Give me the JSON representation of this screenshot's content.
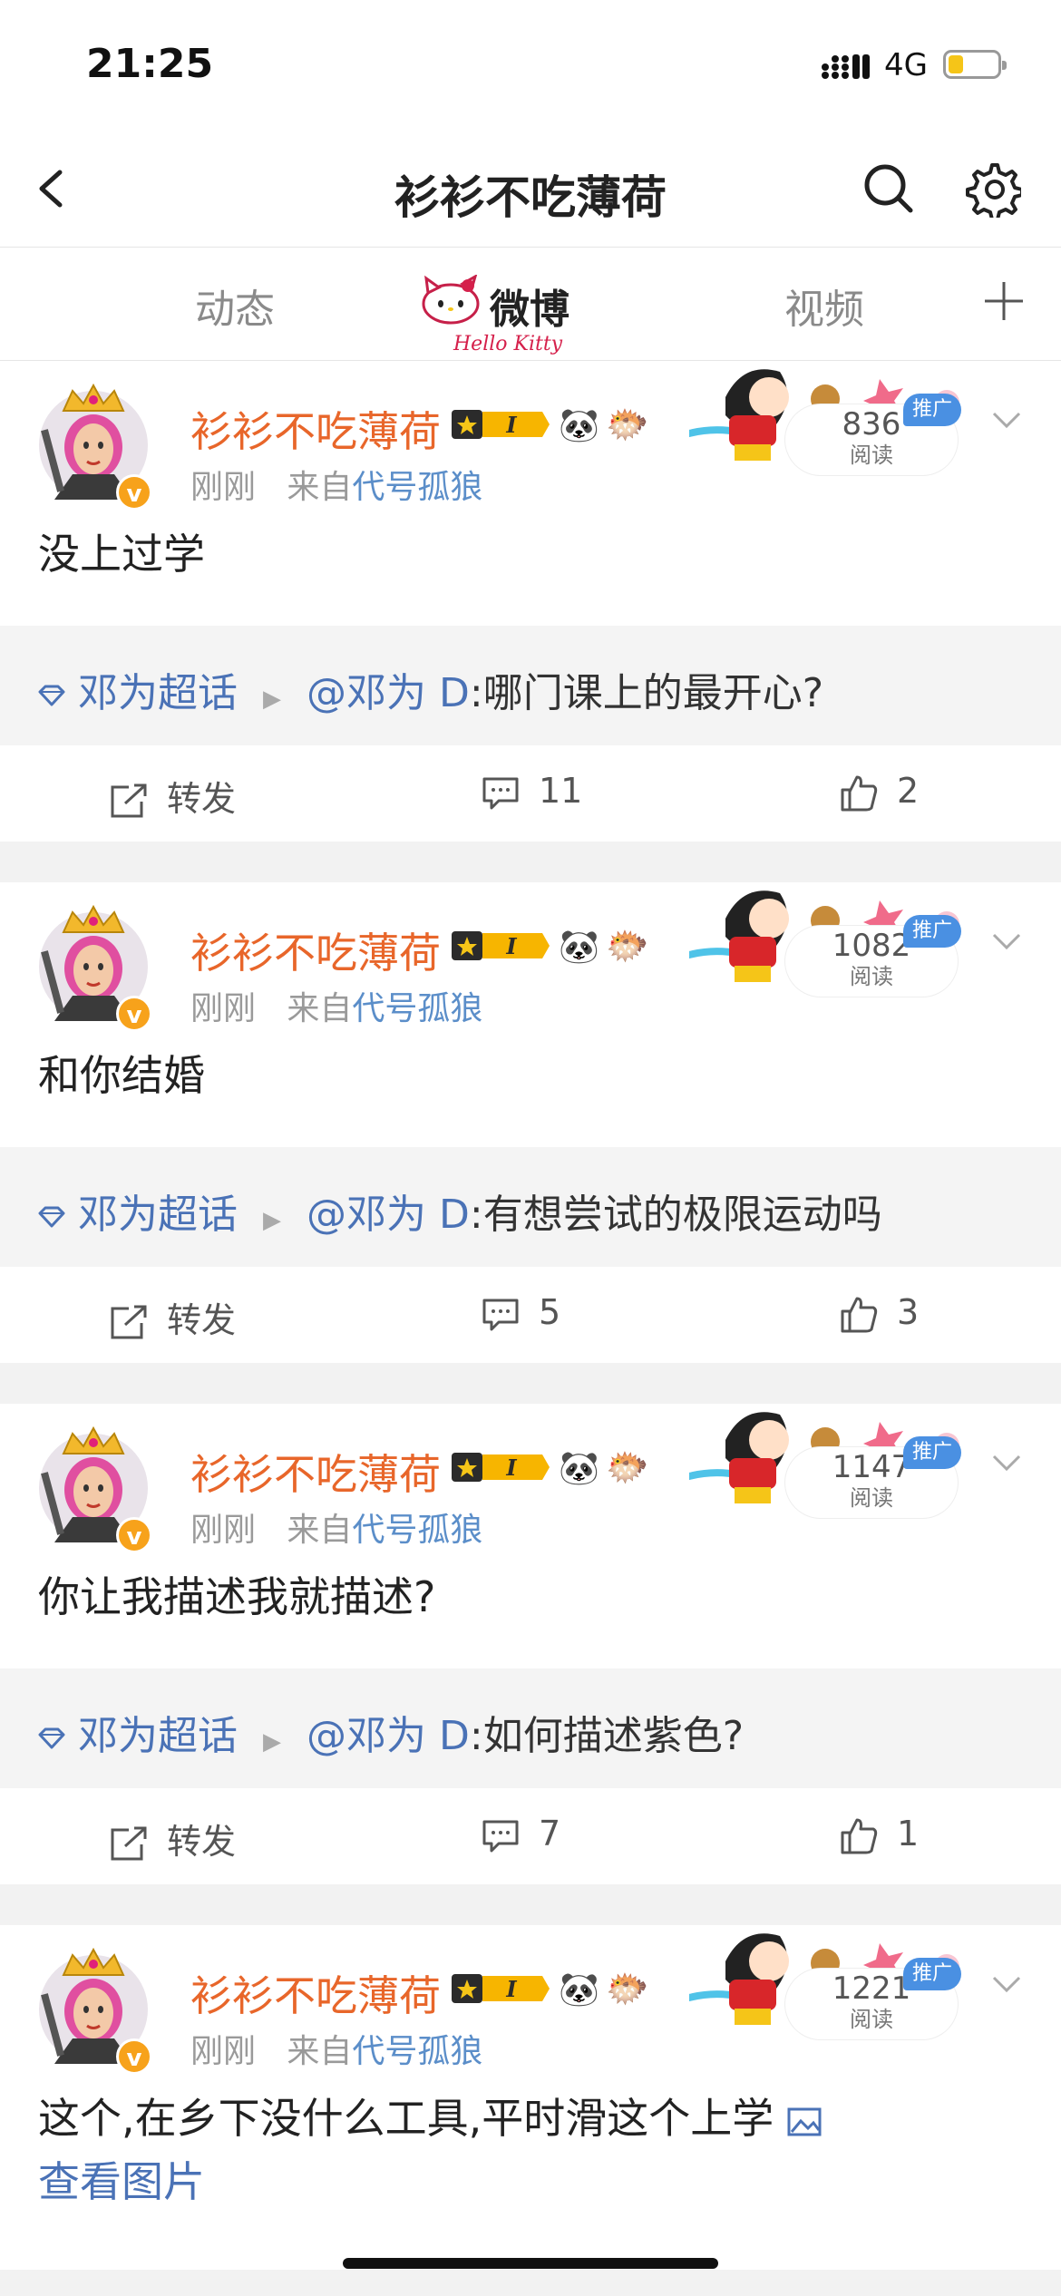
{
  "status": {
    "time": "21:25",
    "network": "4G",
    "battery_level": 0.3
  },
  "header": {
    "title": "衫衫不吃薄荷"
  },
  "tabs": [
    {
      "label": "动态",
      "active": false
    },
    {
      "label": "微博",
      "active": true,
      "decoration_text": "Hello Kitty"
    },
    {
      "label": "视频",
      "active": false
    }
  ],
  "posts": [
    {
      "username": "衫衫不吃薄荷",
      "vip_level": "I",
      "time": "刚刚",
      "source_prefix": "来自",
      "source": "代号孤狼",
      "reads": "836",
      "reads_label": "阅读",
      "promo_label": "推广",
      "text": "没上过学",
      "topic_tag": "邓为超话",
      "topic_at": "@邓为 D",
      "topic_question": ":哪门课上的最开心?",
      "repost_label": "转发",
      "comments": "11",
      "likes": "2"
    },
    {
      "username": "衫衫不吃薄荷",
      "vip_level": "I",
      "time": "刚刚",
      "source_prefix": "来自",
      "source": "代号孤狼",
      "reads": "1082",
      "reads_label": "阅读",
      "promo_label": "推广",
      "text": "和你结婚",
      "topic_tag": "邓为超话",
      "topic_at": "@邓为 D",
      "topic_question": ":有想尝试的极限运动吗",
      "repost_label": "转发",
      "comments": "5",
      "likes": "3"
    },
    {
      "username": "衫衫不吃薄荷",
      "vip_level": "I",
      "time": "刚刚",
      "source_prefix": "来自",
      "source": "代号孤狼",
      "reads": "1147",
      "reads_label": "阅读",
      "promo_label": "推广",
      "text": "你让我描述我就描述?",
      "topic_tag": "邓为超话",
      "topic_at": "@邓为 D",
      "topic_question": ":如何描述紫色?",
      "repost_label": "转发",
      "comments": "7",
      "likes": "1"
    },
    {
      "username": "衫衫不吃薄荷",
      "vip_level": "I",
      "time": "刚刚",
      "source_prefix": "来自",
      "source": "代号孤狼",
      "reads": "1221",
      "reads_label": "阅读",
      "promo_label": "推广",
      "text": "这个,在乡下没什么工具,平时滑这个上学",
      "view_image": "查看图片"
    }
  ],
  "colors": {
    "username": "#e8662a",
    "link": "#4a72b6",
    "promo": "#4a90e2",
    "badge": "#f7a21b"
  }
}
